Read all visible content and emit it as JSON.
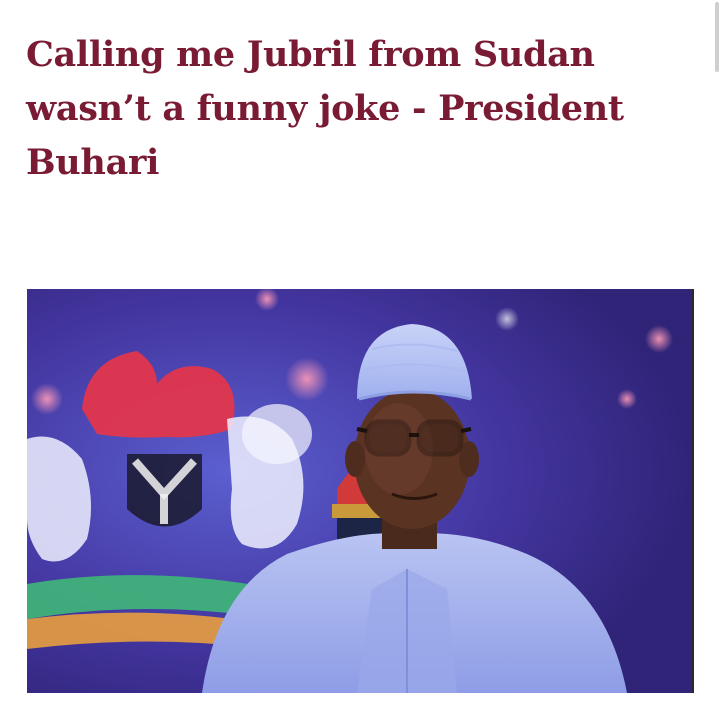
{
  "article": {
    "headline": "Calling me Jubril from Sudan wasn’t a funny joke - President Buhari"
  },
  "colors": {
    "headline": "#7a1b34",
    "background": "#ffffff"
  }
}
